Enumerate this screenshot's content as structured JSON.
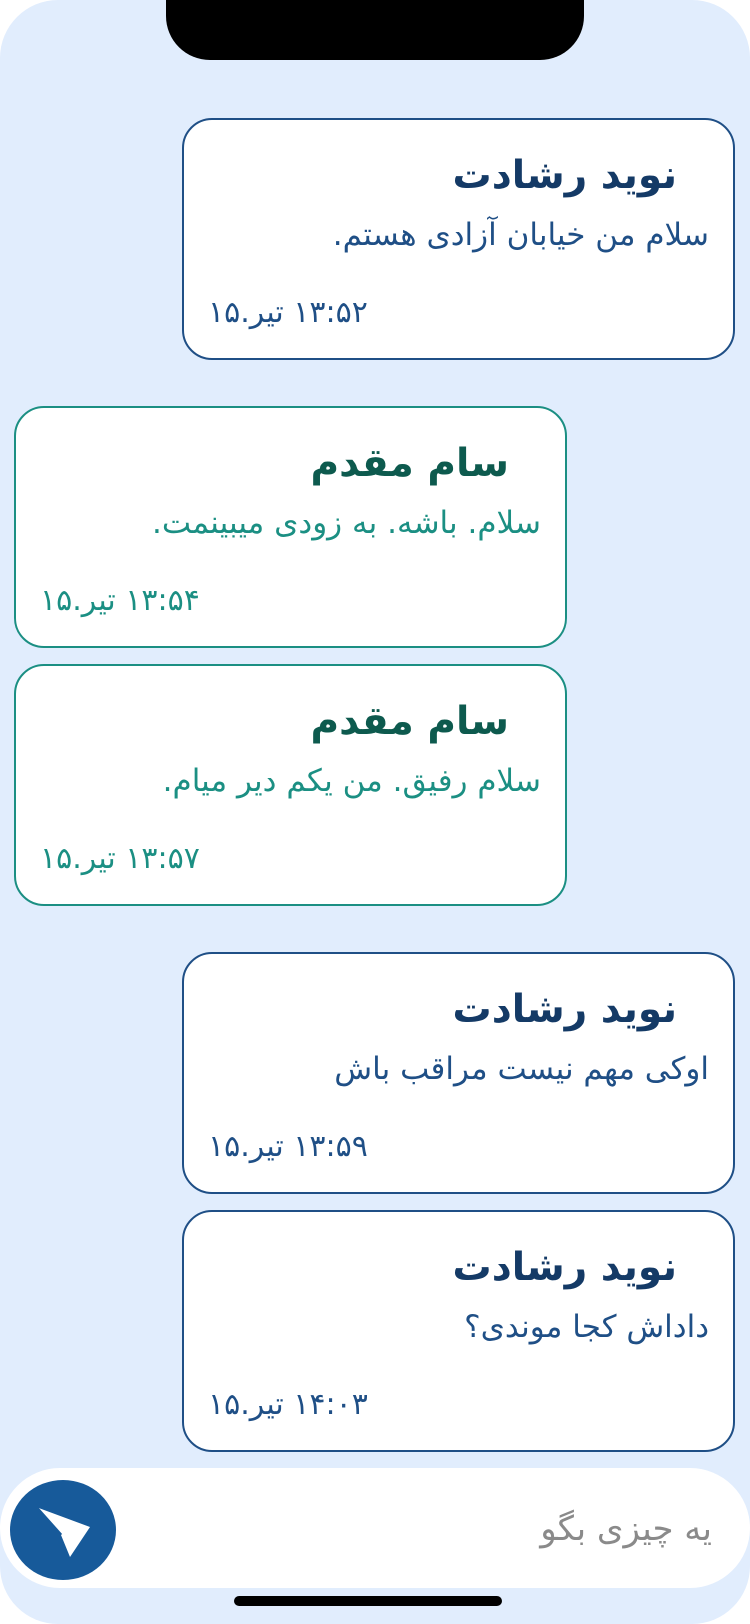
{
  "messages": [
    {
      "sender": "نوید رشادت",
      "text": "سلام من خیابان آزادی هستم.",
      "time": "۱۳:۵۲ تیر.۱۵",
      "side": "me"
    },
    {
      "sender": "سام مقدم",
      "text": "سلام. باشه. به زودی میبینمت.",
      "time": "۱۳:۵۴ تیر.۱۵",
      "side": "other"
    },
    {
      "sender": "سام مقدم",
      "text": "سلام رفیق. من یکم دیر میام.",
      "time": "۱۳:۵۷ تیر.۱۵",
      "side": "other"
    },
    {
      "sender": "نوید رشادت",
      "text": "اوکی مهم نیست مراقب باش",
      "time": "۱۳:۵۹ تیر.۱۵",
      "side": "me"
    },
    {
      "sender": "نوید رشادت",
      "text": "داداش کجا موندی؟",
      "time": "۱۴:۰۳ تیر.۱۵",
      "side": "me"
    }
  ],
  "composer": {
    "placeholder": "یه چیزی بگو",
    "value": "",
    "send_icon": "paper-plane-icon"
  },
  "colors": {
    "background": "#e1edfd",
    "me_border": "#1f4f86",
    "other_border": "#1b8f83",
    "send_button": "#175a9a"
  }
}
